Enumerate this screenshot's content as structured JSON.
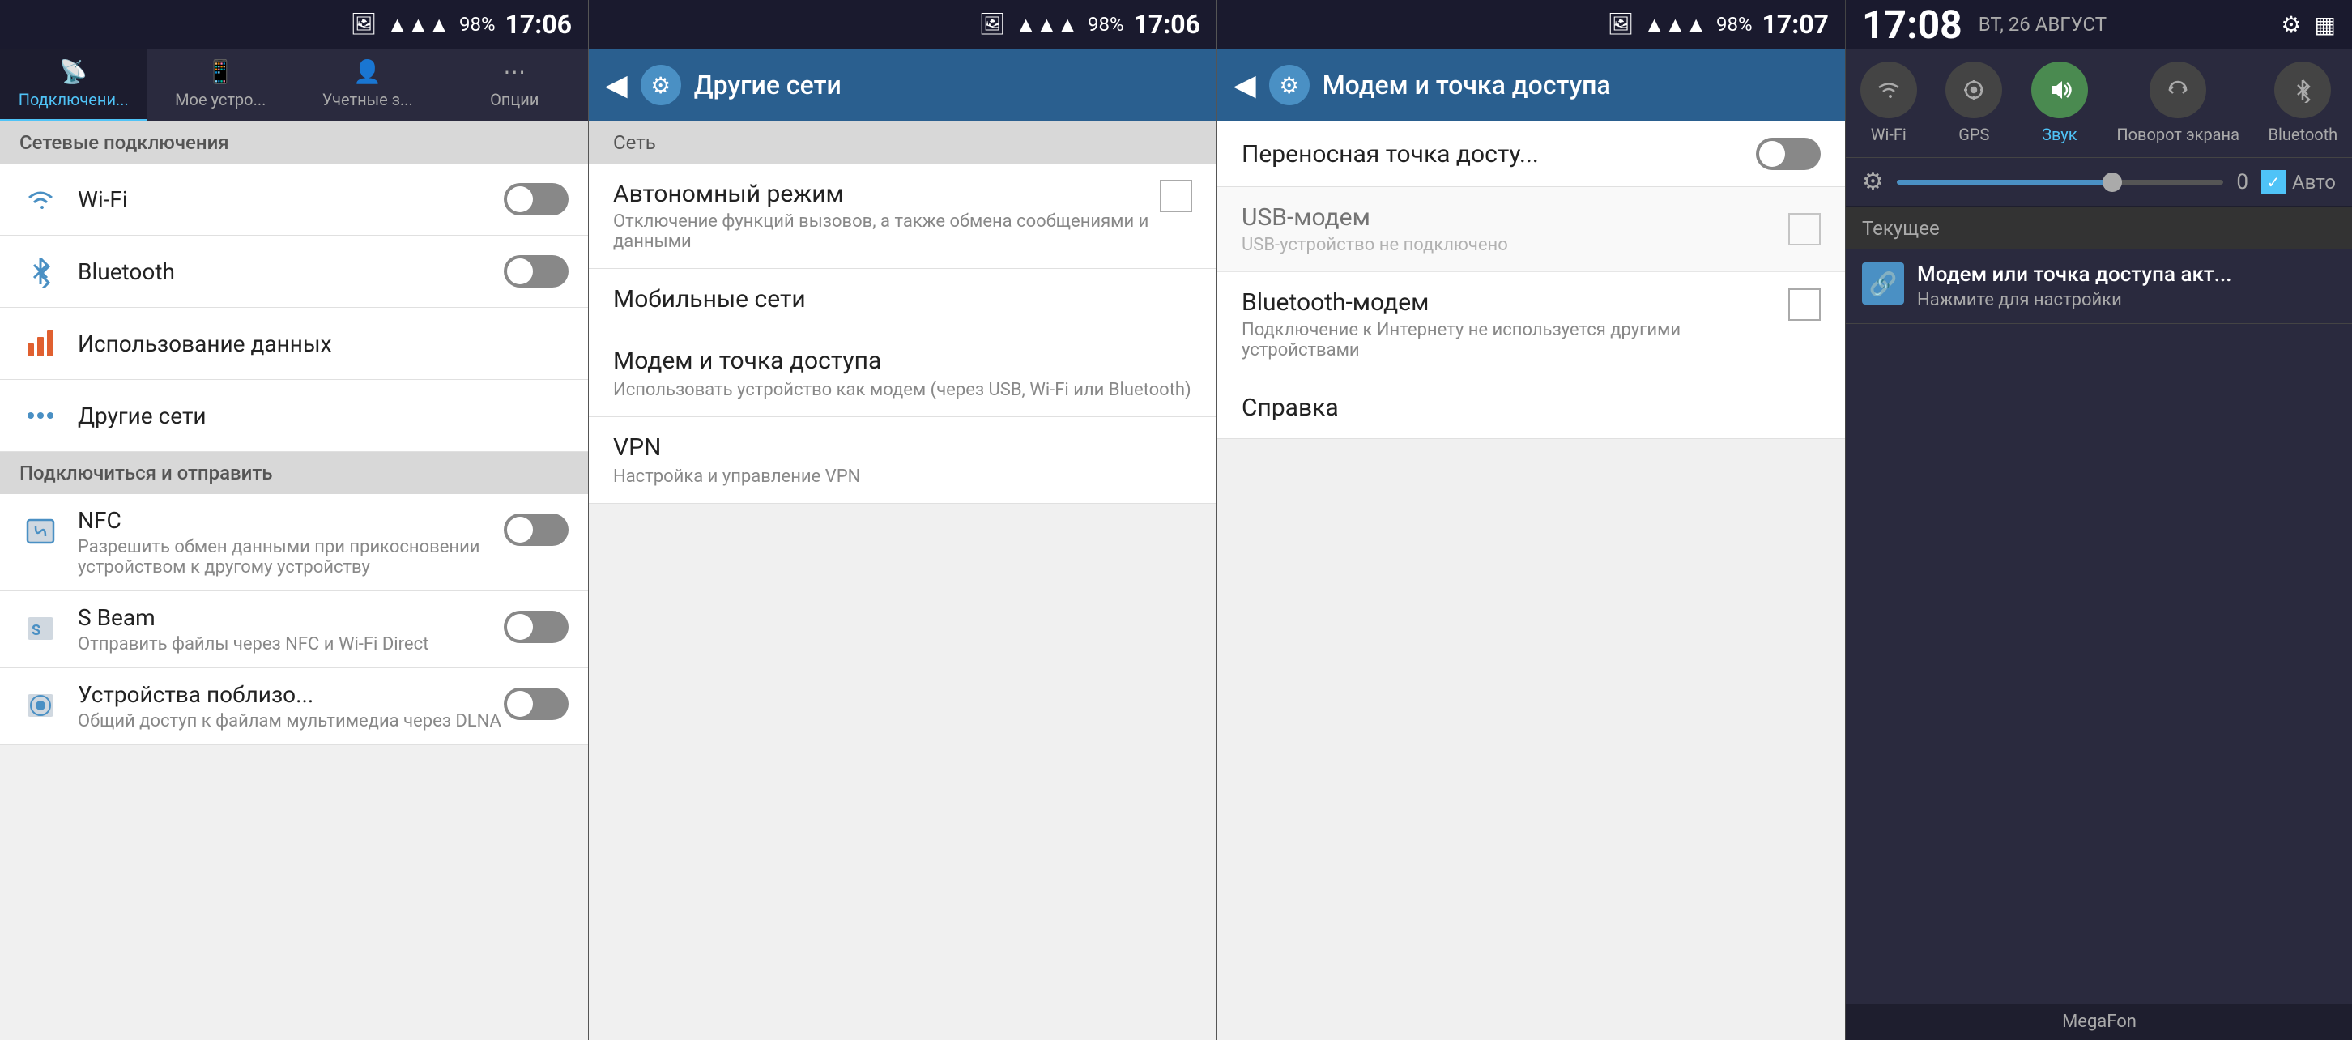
{
  "panel1": {
    "status": {
      "signal": "▲▲▲",
      "battery": "98%",
      "time": "17:06",
      "camera_icon": "📷"
    },
    "tabs": [
      {
        "id": "connections",
        "label": "Подключени...",
        "icon": "📡",
        "active": true
      },
      {
        "id": "my-device",
        "label": "Мое устро...",
        "icon": "📱",
        "active": false
      },
      {
        "id": "accounts",
        "label": "Учетные з...",
        "icon": "👤",
        "active": false
      },
      {
        "id": "options",
        "label": "Опции",
        "icon": "⋯",
        "active": false
      }
    ],
    "sections": [
      {
        "header": "Сетевые подключения",
        "items": [
          {
            "id": "wifi",
            "icon": "wifi",
            "title": "Wi-Fi",
            "toggle": true,
            "toggle_on": false
          },
          {
            "id": "bluetooth",
            "icon": "bluetooth",
            "title": "Bluetooth",
            "toggle": true,
            "toggle_on": false
          }
        ]
      },
      {
        "header": null,
        "items": [
          {
            "id": "data-usage",
            "icon": "data",
            "title": "Использование данных",
            "toggle": false
          },
          {
            "id": "other-networks",
            "icon": "dots",
            "title": "Другие сети",
            "toggle": false
          }
        ]
      },
      {
        "header": "Подключиться и отправить",
        "items": [
          {
            "id": "nfc",
            "icon": "nfc",
            "title": "NFC",
            "desc": "Разрешить обмен данными при прикосновении устройством к другому устройству",
            "toggle": true,
            "toggle_on": false
          },
          {
            "id": "sbeam",
            "icon": "sbeam",
            "title": "S Beam",
            "desc": "Отправить файлы через NFC и Wi-Fi Direct",
            "toggle": true,
            "toggle_on": false
          },
          {
            "id": "nearby",
            "icon": "nearby",
            "title": "Устройства поблизо...",
            "desc": "Общий доступ к файлам мультимедиа через DLNA",
            "toggle": true,
            "toggle_on": false
          }
        ]
      }
    ]
  },
  "panel2": {
    "status": {
      "signal": "▲▲▲",
      "battery": "98%",
      "time": "17:06",
      "camera_icon": "📷"
    },
    "header": {
      "back_label": "◀",
      "title": "Другие сети"
    },
    "sections": [
      {
        "header": "Сеть",
        "items": [
          {
            "id": "airplane",
            "title": "Автономный режим",
            "desc": "Отключение функций вызовов, а также обмена сообщениями и данными",
            "has_checkbox": true
          }
        ]
      },
      {
        "header": null,
        "items": [
          {
            "id": "mobile-networks",
            "title": "Мобильные сети",
            "desc": null,
            "has_checkbox": false
          },
          {
            "id": "tethering",
            "title": "Модем и точка доступа",
            "desc": "Использовать устройство как модем (через USB, Wi-Fi или Bluetooth)",
            "has_checkbox": false
          },
          {
            "id": "vpn",
            "title": "VPN",
            "desc": "Настройка и управление VPN",
            "has_checkbox": false
          }
        ]
      }
    ]
  },
  "panel3": {
    "status": {
      "signal": "▲▲▲",
      "battery": "98%",
      "time": "17:07",
      "camera_icon": "📷"
    },
    "header": {
      "back_label": "◀",
      "title": "Модем и точка доступа"
    },
    "items": [
      {
        "id": "hotspot",
        "title": "Переносная точка досту...",
        "desc": null,
        "has_toggle": true,
        "toggle_on": false
      },
      {
        "id": "usb-tether",
        "title": "USB-модем",
        "desc": "USB-устройство не подключено",
        "has_toggle": false,
        "has_checkbox": true,
        "disabled": true
      },
      {
        "id": "bt-tether",
        "title": "Bluetooth-модем",
        "desc": "Подключение к Интернету не используется другими устройствами",
        "has_toggle": false,
        "has_checkbox": true,
        "disabled": false
      },
      {
        "id": "help",
        "title": "Справка",
        "desc": null,
        "has_toggle": false,
        "has_checkbox": false
      }
    ]
  },
  "panel4": {
    "time": "17:08",
    "date": "ВТ, 26 АВГУСТ",
    "quick_toggles": [
      {
        "id": "wifi",
        "icon": "📶",
        "label": "Wi-Fi",
        "active": false
      },
      {
        "id": "gps",
        "icon": "◎",
        "label": "GPS",
        "active": false
      },
      {
        "id": "sound",
        "icon": "🔊",
        "label": "Звук",
        "active": true
      },
      {
        "id": "rotate",
        "icon": "↺",
        "label": "Поворот экрана",
        "active": false
      },
      {
        "id": "bluetooth",
        "icon": "⌖",
        "label": "Bluetooth",
        "active": false
      }
    ],
    "brightness": {
      "value": "0",
      "auto_label": "Авто",
      "slider_percent": 65
    },
    "notifications_label": "Текущее",
    "notifications": [
      {
        "id": "hotspot-notif",
        "icon": "🔗",
        "title": "Модем или точка доступа акт...",
        "desc": "Нажмите для настройки"
      }
    ],
    "carrier": "MegaFon"
  }
}
